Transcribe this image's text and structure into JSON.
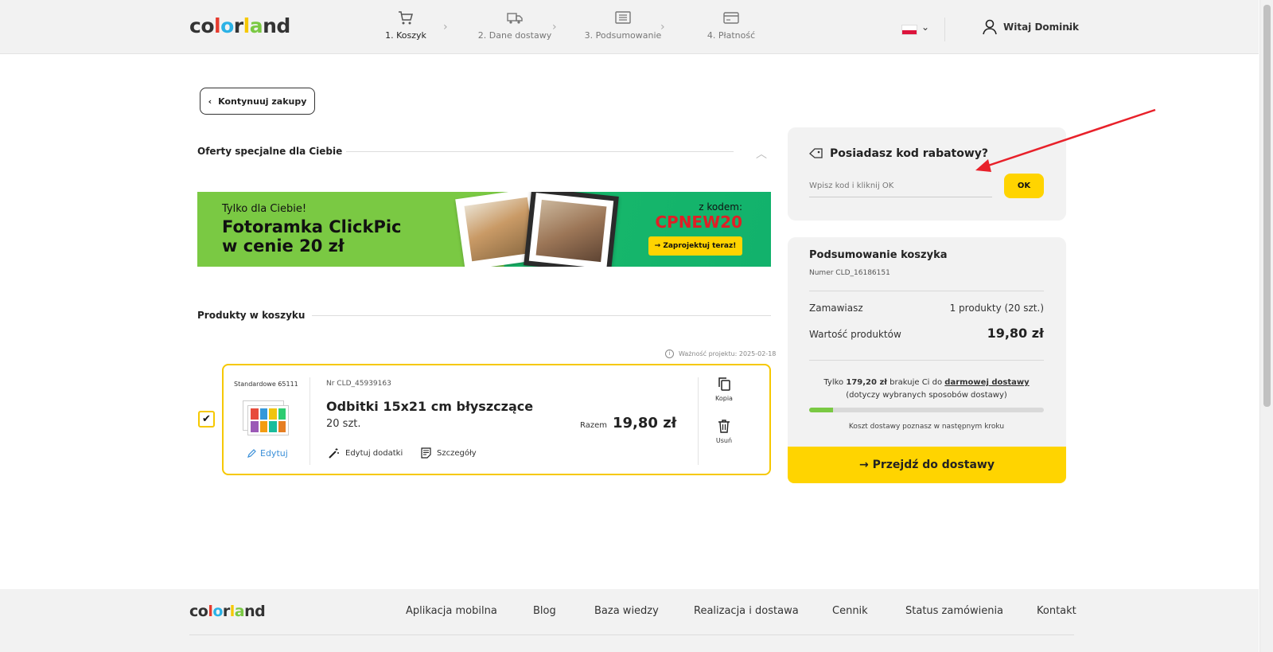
{
  "header": {
    "logo_text": "colorland",
    "steps": [
      {
        "label": "1. Koszyk",
        "icon": "cart-icon",
        "active": true
      },
      {
        "label": "2. Dane dostawy",
        "icon": "truck-icon",
        "active": false
      },
      {
        "label": "3. Podsumowanie",
        "icon": "list-icon",
        "active": false
      },
      {
        "label": "4. Płatność",
        "icon": "card-icon",
        "active": false
      }
    ],
    "language_flag": "flag-pl-icon",
    "user_greeting": "Witaj Dominik"
  },
  "main": {
    "continue_label": "Kontynuuj zakupy",
    "offers_title": "Oferty specjalne dla Ciebie",
    "banner": {
      "subtitle": "Tylko dla Ciebie!",
      "headline_line1": "Fotoramka ClickPic",
      "headline_line2": "w cenie 20 zł",
      "code_label": "z kodem:",
      "code": "CPNEW20",
      "cta": "→ Zaprojektuj teraz!"
    },
    "products_title": "Produkty w koszyku",
    "validity": "Ważność projektu: 2025-02-18",
    "item": {
      "checked": true,
      "type_label": "Standardowe 65111",
      "edit_label": "Edytuj",
      "number": "Nr CLD_45939163",
      "title": "Odbitki 15x21 cm błyszczące",
      "quantity": "20 szt.",
      "edit_addons_label": "Edytuj dodatki",
      "details_label": "Szczegóły",
      "total_label": "Razem",
      "price": "19,80 zł",
      "copy_label": "Kopia",
      "delete_label": "Usuń"
    }
  },
  "coupon": {
    "title": "Posiadasz kod rabatowy?",
    "placeholder": "Wpisz kod i kliknij OK",
    "ok_label": "OK"
  },
  "summary": {
    "title": "Podsumowanie koszyka",
    "number": "Numer CLD_16186151",
    "ordering_label": "Zamawiasz",
    "ordering_value": "1 produkty (20 szt.)",
    "value_label": "Wartość produktów",
    "value": "19,80 zł",
    "free_prefix": "Tylko",
    "free_amount": "179,20 zł",
    "free_middle": "brakuje Ci do",
    "free_link": "darmowej dostawy",
    "free_suffix": "(dotyczy wybranych sposobów dostawy)",
    "free_progress": 0.1,
    "shipping_note": "Koszt dostawy poznasz w następnym kroku",
    "proceed_label": "→ Przejdź do dostawy"
  },
  "footer": {
    "logo_text": "colorland",
    "links": [
      "Aplikacja mobilna",
      "Blog",
      "Baza wiedzy",
      "Realizacja i dostawa",
      "Cennik",
      "Status zamówienia",
      "Kontakt"
    ]
  },
  "colors": {
    "accent_yellow": "#ffd400",
    "banner_green": "#7ac943",
    "code_red": "#e01f26",
    "link_blue": "#3a8fd8",
    "annotation_arrow": "#e8212a"
  }
}
